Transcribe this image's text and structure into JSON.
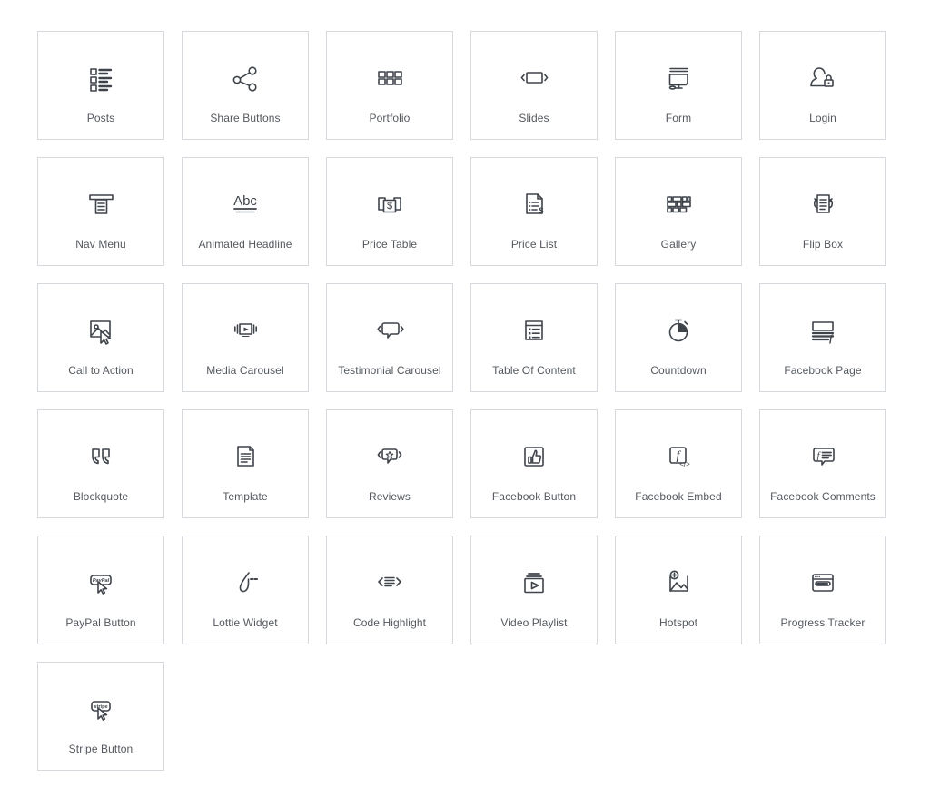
{
  "grid": {
    "columns": 6,
    "icon_color": "#3f444b",
    "label_color": "#54595f",
    "card_border_color": "#d5d8dc",
    "background": "#ffffff",
    "widgets": [
      {
        "label": "Posts",
        "icon": "posts-list-icon"
      },
      {
        "label": "Share Buttons",
        "icon": "share-nodes-icon"
      },
      {
        "label": "Portfolio",
        "icon": "grid-six-squares-icon"
      },
      {
        "label": "Slides",
        "icon": "slide-arrows-icon"
      },
      {
        "label": "Form",
        "icon": "form-screen-icon"
      },
      {
        "label": "Login",
        "icon": "user-lock-icon"
      },
      {
        "label": "Nav Menu",
        "icon": "nav-dropdown-icon"
      },
      {
        "label": "Animated Headline",
        "icon": "abc-underline-icon"
      },
      {
        "label": "Price Table",
        "icon": "price-panels-dollar-icon"
      },
      {
        "label": "Price List",
        "icon": "price-document-dollar-icon"
      },
      {
        "label": "Gallery",
        "icon": "gallery-masonry-icon"
      },
      {
        "label": "Flip Box",
        "icon": "flip-card-arrows-icon"
      },
      {
        "label": "Call to Action",
        "icon": "image-cursor-icon"
      },
      {
        "label": "Media Carousel",
        "icon": "media-play-carousel-icon"
      },
      {
        "label": "Testimonial Carousel",
        "icon": "speech-bubble-arrows-icon"
      },
      {
        "label": "Table Of Content",
        "icon": "document-list-icon"
      },
      {
        "label": "Countdown",
        "icon": "stopwatch-icon"
      },
      {
        "label": "Facebook Page",
        "icon": "facebook-page-banner-icon"
      },
      {
        "label": "Blockquote",
        "icon": "quotation-marks-icon"
      },
      {
        "label": "Template",
        "icon": "document-folded-icon"
      },
      {
        "label": "Reviews",
        "icon": "speech-bubble-star-icon"
      },
      {
        "label": "Facebook Button",
        "icon": "thumbs-up-box-icon"
      },
      {
        "label": "Facebook Embed",
        "icon": "facebook-code-icon"
      },
      {
        "label": "Facebook Comments",
        "icon": "facebook-comment-bubble-icon"
      },
      {
        "label": "PayPal Button",
        "icon": "paypal-button-cursor-icon"
      },
      {
        "label": "Lottie Widget",
        "icon": "lottie-stroke-icon"
      },
      {
        "label": "Code Highlight",
        "icon": "code-brackets-lines-icon"
      },
      {
        "label": "Video Playlist",
        "icon": "video-playlist-play-icon"
      },
      {
        "label": "Hotspot",
        "icon": "image-plus-icon"
      },
      {
        "label": "Progress Tracker",
        "icon": "browser-progress-bar-icon"
      },
      {
        "label": "Stripe Button",
        "icon": "stripe-button-cursor-icon"
      }
    ],
    "icon_inner_text": {
      "animated_headline": "Abc",
      "paypal": "PayPal",
      "stripe": "stripe",
      "facebook_letter": "f",
      "dollar": "$"
    }
  }
}
